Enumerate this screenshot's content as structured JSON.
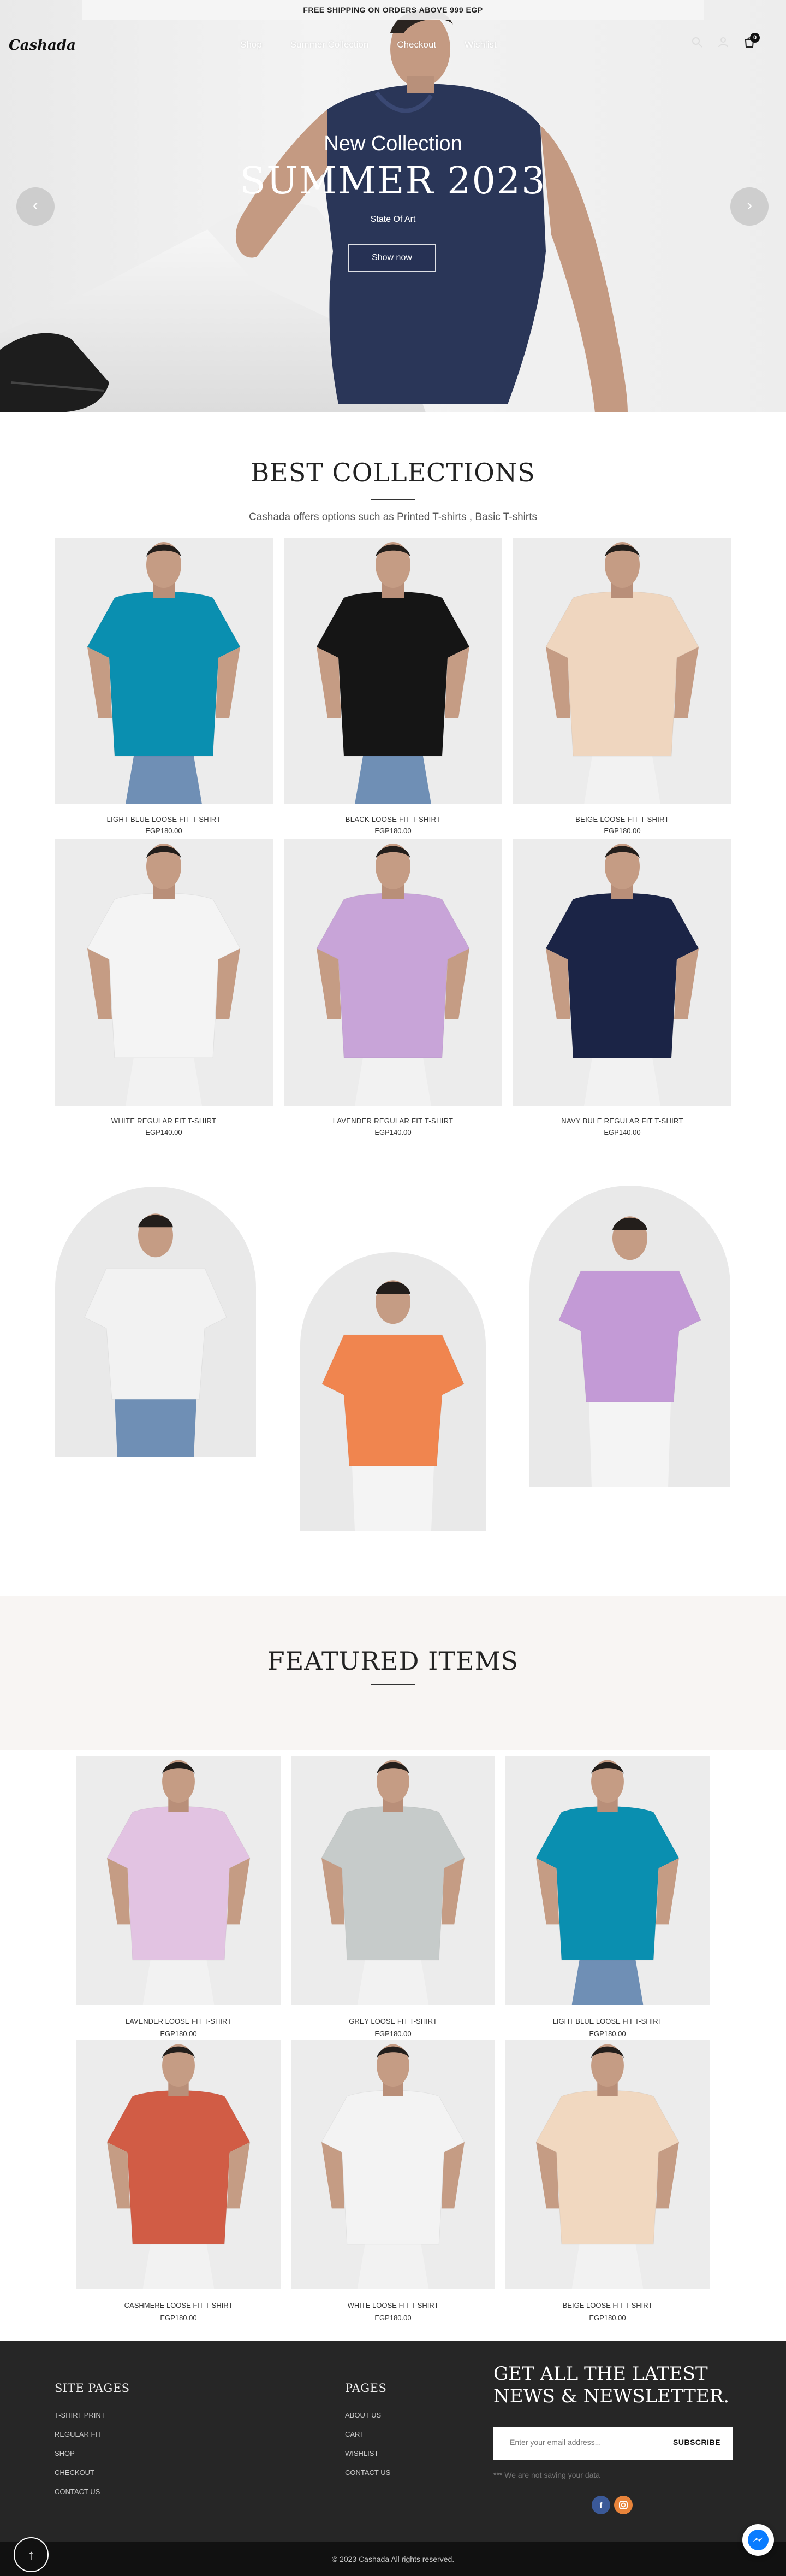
{
  "topbar": {
    "text": "FREE SHIPPING ON ORDERS ABOVE 999 EGP"
  },
  "header": {
    "logo": "Cashada",
    "nav": [
      "Shop",
      "Summer Collection",
      "Checkout",
      "Wishlist"
    ],
    "cart_count": "0"
  },
  "hero": {
    "subtitle": "New Collection",
    "title": "SUMMER 2023",
    "tagline": "State Of Art",
    "button": "Show now",
    "prev": "‹",
    "next": "›"
  },
  "best": {
    "title": "BEST COLLECTIONS",
    "description": "Cashada offers options such as Printed T-shirts , Basic T-shirts",
    "products": [
      {
        "name": "LIGHT BLUE LOOSE FIT T-SHIRT",
        "price": "EGP180.00",
        "color": "#0a8fb0"
      },
      {
        "name": "BLACK LOOSE FIT T-SHIRT",
        "price": "EGP180.00",
        "color": "#151515"
      },
      {
        "name": "BEIGE LOOSE FIT T-SHIRT",
        "price": "EGP180.00",
        "color": "#efd6bf"
      },
      {
        "name": "WHITE REGULAR FIT T-SHIRT",
        "price": "EGP140.00",
        "color": "#f4f4f4"
      },
      {
        "name": "LAVENDER REGULAR FIT T-SHIRT",
        "price": "EGP140.00",
        "color": "#c8a4d8"
      },
      {
        "name": "NAVY BULE REGULAR FIT T-SHIRT",
        "price": "EGP140.00",
        "color": "#1b2446"
      }
    ],
    "arch_colors": [
      "#f2f2f2",
      "#f0854f",
      "#c39ad6"
    ]
  },
  "featured": {
    "title": "FEATURED ITEMS",
    "products": [
      {
        "name": "LAVENDER LOOSE FIT T-SHIRT",
        "price": "EGP180.00",
        "color": "#e2c3e2"
      },
      {
        "name": "GREY LOOSE FIT T-SHIRT",
        "price": "EGP180.00",
        "color": "#c6cbca"
      },
      {
        "name": "LIGHT BLUE LOOSE FIT T-SHIRT",
        "price": "EGP180.00",
        "color": "#0a8fb0"
      },
      {
        "name": "CASHMERE LOOSE FIT T-SHIRT",
        "price": "EGP180.00",
        "color": "#d15c45"
      },
      {
        "name": "WHITE LOOSE FIT T-SHIRT",
        "price": "EGP180.00",
        "color": "#f3f3f3"
      },
      {
        "name": "BEIGE LOOSE FIT T-SHIRT",
        "price": "EGP180.00",
        "color": "#f1d8c0"
      }
    ]
  },
  "footer": {
    "site_pages_title": "SITE PAGES",
    "site_pages": [
      "T-SHIRT PRINT",
      "REGULAR FIT",
      "SHOP",
      "CHECKOUT",
      "CONTACT US"
    ],
    "pages_title": "PAGES",
    "pages": [
      "ABOUT US",
      "CART",
      "WISHLIST",
      "CONTACT US"
    ],
    "newsletter_title": "GET ALL THE LATEST NEWS & NEWSLETTER.",
    "email_placeholder": "Enter your email address...",
    "subscribe": "SUBSCRIBE",
    "note": "*** We are not saving your data",
    "copyright": "© 2023 Cashada All rights reserved.",
    "to_top": "↑"
  },
  "colors": {
    "accent": "#262626",
    "facebook": "#3b5998",
    "instagram": "#e8833a",
    "messenger": "#0a7cff"
  }
}
